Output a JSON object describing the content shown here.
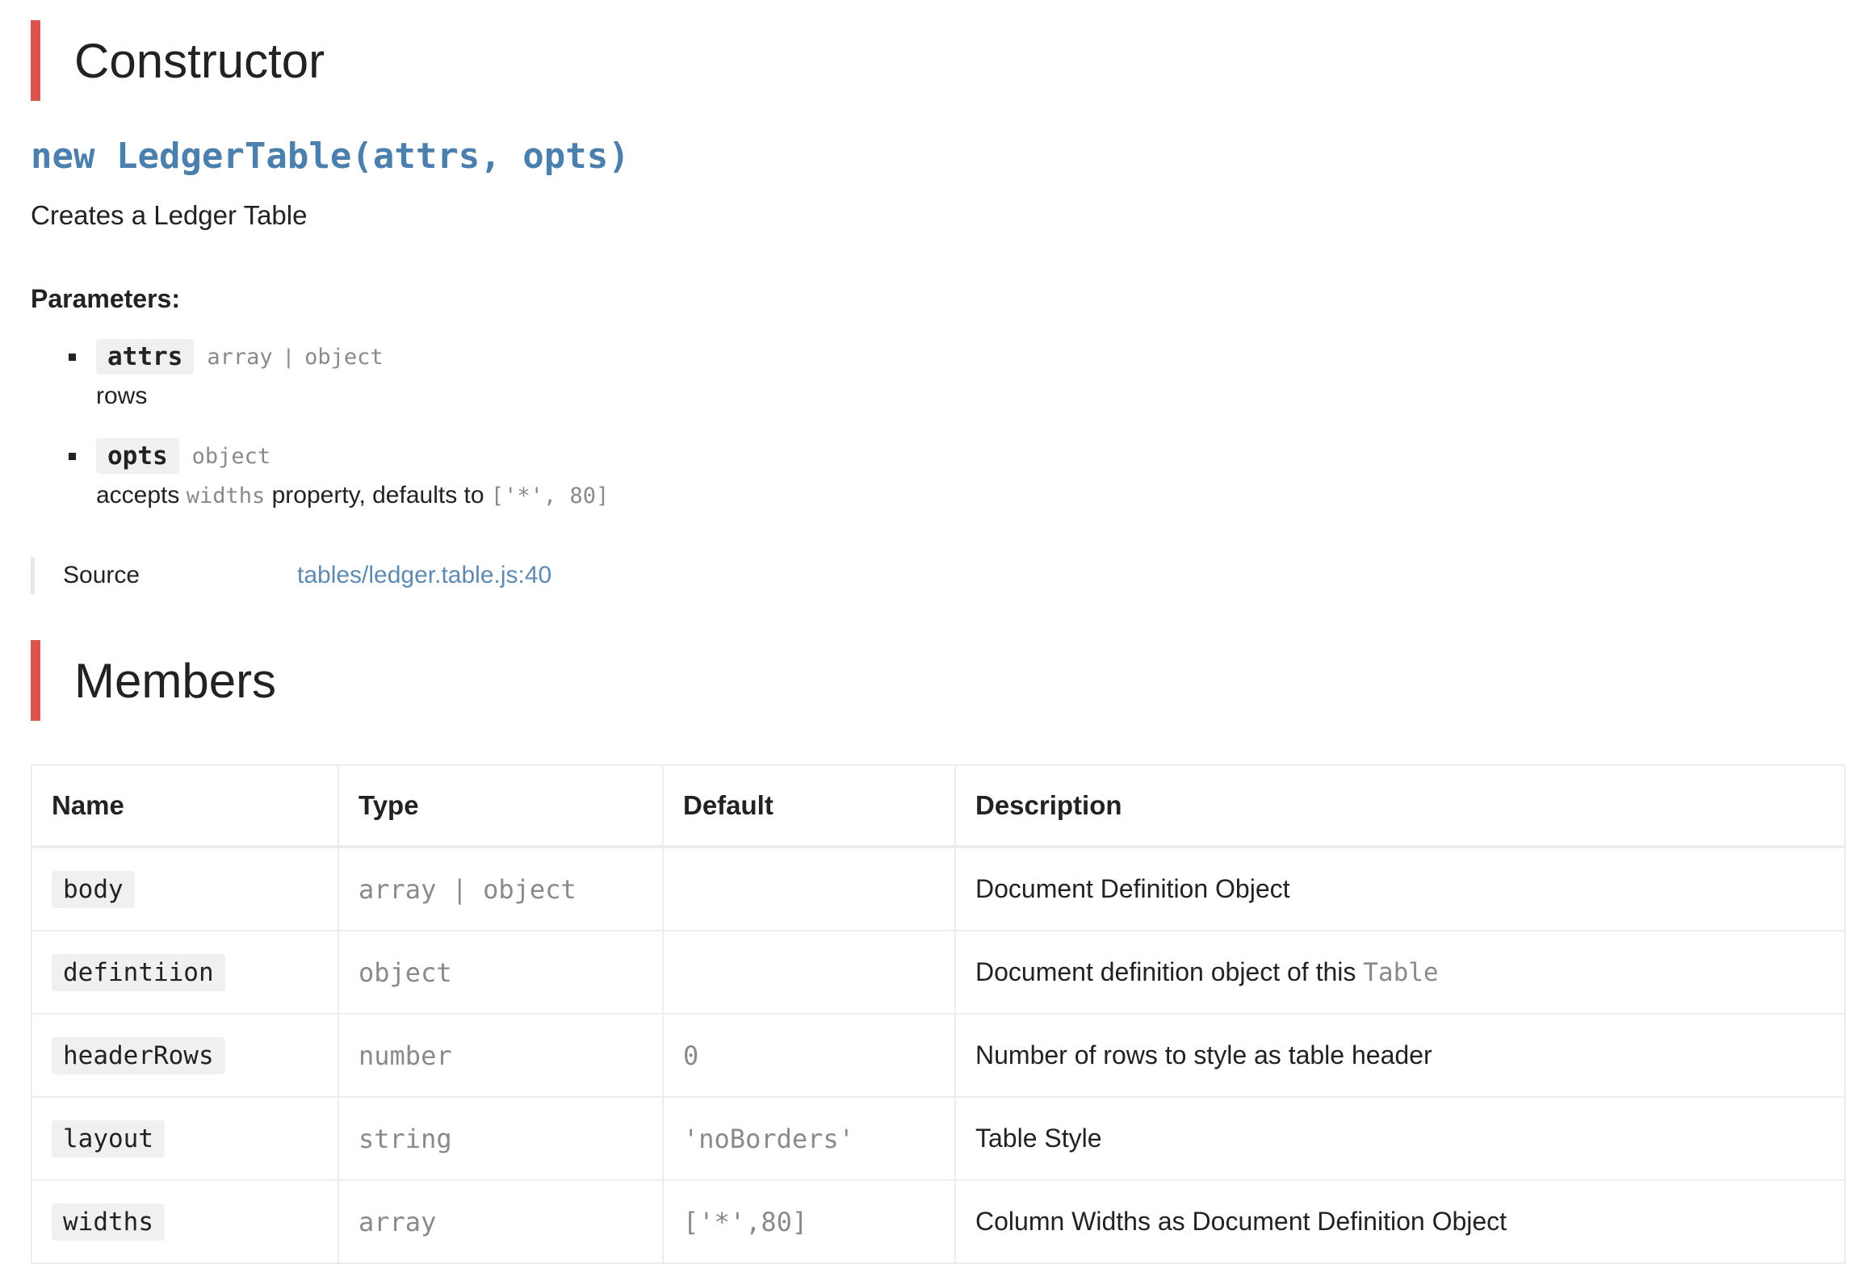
{
  "constructor_section": {
    "heading": "Constructor",
    "signature": "new LedgerTable(attrs, opts)",
    "description": "Creates a Ledger Table",
    "params_title": "Parameters:",
    "params": [
      {
        "name": "attrs",
        "type_a": "array",
        "type_sep": "|",
        "type_b": "object",
        "description": "rows"
      },
      {
        "name": "opts",
        "type": "object",
        "desc_prefix": "accepts",
        "desc_code": "widths",
        "desc_middle": "property, defaults to",
        "desc_default": "['*', 80]"
      }
    ],
    "source_label": "Source",
    "source_link": "tables/ledger.table.js:40"
  },
  "members_section": {
    "heading": "Members",
    "columns": [
      "Name",
      "Type",
      "Default",
      "Description"
    ],
    "rows": [
      {
        "name": "body",
        "type": "array | object",
        "default": "",
        "description": "Document Definition Object"
      },
      {
        "name": "defintiion",
        "type": "object",
        "default": "",
        "description": "Document definition object of this",
        "description_code": "Table"
      },
      {
        "name": "headerRows",
        "type": "number",
        "default": "0",
        "description": "Number of rows to style as table header"
      },
      {
        "name": "layout",
        "type": "string",
        "default": "'noBorders'",
        "description": "Table Style"
      },
      {
        "name": "widths",
        "type": "array",
        "default": "['*',80]",
        "description": "Column Widths as Document Definition Object"
      }
    ]
  },
  "colors": {
    "accent": "#d9534f",
    "link": "#5d89b3",
    "signature": "#4a7fae",
    "muted_code": "#8a8a8a"
  }
}
